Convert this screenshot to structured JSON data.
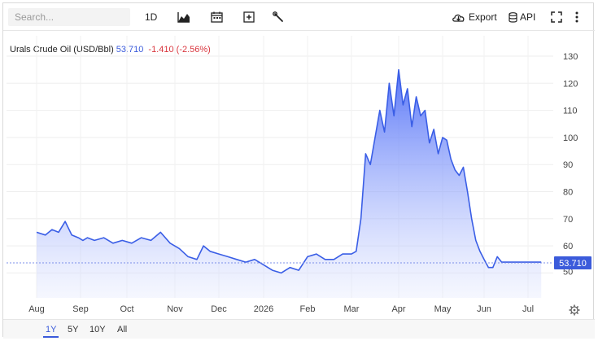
{
  "toolbar": {
    "search_placeholder": "Search...",
    "interval_label": "1D",
    "export_label": "Export",
    "api_label": "API"
  },
  "legend": {
    "name": "Urals Crude Oil (USD/Bbl)",
    "value": "53.710",
    "change": "-1.410 (-2.56%)"
  },
  "ranges": {
    "r1": "1Y",
    "r2": "5Y",
    "r3": "10Y",
    "r4": "All",
    "active": "1Y"
  },
  "colors": {
    "line": "#3a5ee6",
    "area_top": "#4f6ef7",
    "up": "#3b5bdb",
    "down": "#d9363e"
  },
  "icons": [
    "chart-type-icon",
    "calendar-icon",
    "add-indicator-icon",
    "wrench-icon",
    "cloud-download-icon",
    "database-icon",
    "fullscreen-icon",
    "more-vertical-icon",
    "gear-icon"
  ],
  "chart_data": {
    "type": "area",
    "title": "Urals Crude Oil (USD/Bbl)",
    "x_labels": [
      "Aug",
      "Sep",
      "Oct",
      "Nov",
      "Dec",
      "2026",
      "Feb",
      "Mar",
      "Apr",
      "May",
      "Jun",
      "Jul"
    ],
    "ylim": [
      44,
      133
    ],
    "y_ticks": [
      50,
      60,
      70,
      80,
      90,
      100,
      110,
      120,
      130
    ],
    "last_value": 53.71,
    "last_label": "53.710",
    "grid": true,
    "series": [
      {
        "x": [
          0,
          0.2,
          0.35,
          0.5,
          0.65,
          0.8,
          0.95,
          1.05,
          1.15,
          1.3,
          1.5,
          1.7,
          1.9,
          2.1,
          2.3,
          2.5,
          2.7,
          2.9,
          3.1,
          3.3,
          3.5,
          3.65,
          3.8,
          4.0,
          4.2,
          4.4,
          4.6,
          4.8,
          5.0,
          5.2,
          5.4,
          5.6,
          5.8,
          6.0,
          6.2,
          6.4,
          6.6,
          6.8,
          7.0,
          7.1,
          7.2,
          7.3,
          7.4,
          7.5,
          7.6,
          7.7,
          7.8,
          7.9,
          8.0,
          8.1,
          8.2,
          8.3,
          8.4,
          8.5,
          8.6,
          8.7,
          8.8,
          8.9,
          9.0,
          9.1,
          9.2,
          9.3,
          9.4,
          9.5,
          9.6,
          9.7,
          9.8,
          9.9,
          10.0,
          10.1,
          10.2,
          10.3,
          10.4,
          10.5,
          10.6,
          10.7,
          10.8,
          10.9,
          11.0,
          11.1,
          11.2,
          11.3
        ],
        "y": [
          65,
          64,
          66,
          65,
          69,
          64,
          63,
          62,
          63,
          62,
          63,
          61,
          62,
          61,
          63,
          62,
          65,
          61,
          59,
          56,
          55,
          60,
          58,
          57,
          56,
          55,
          54,
          55,
          53,
          51,
          50,
          52,
          51,
          56,
          57,
          55,
          55,
          57,
          57,
          58,
          70,
          94,
          90,
          100,
          110,
          102,
          120,
          108,
          125,
          112,
          118,
          104,
          115,
          108,
          110,
          98,
          103,
          94,
          100,
          99,
          92,
          88,
          86,
          89,
          80,
          70,
          62,
          58,
          55,
          52,
          52,
          56,
          54,
          54,
          54,
          54,
          54,
          54,
          54,
          54,
          54,
          54
        ]
      }
    ]
  }
}
